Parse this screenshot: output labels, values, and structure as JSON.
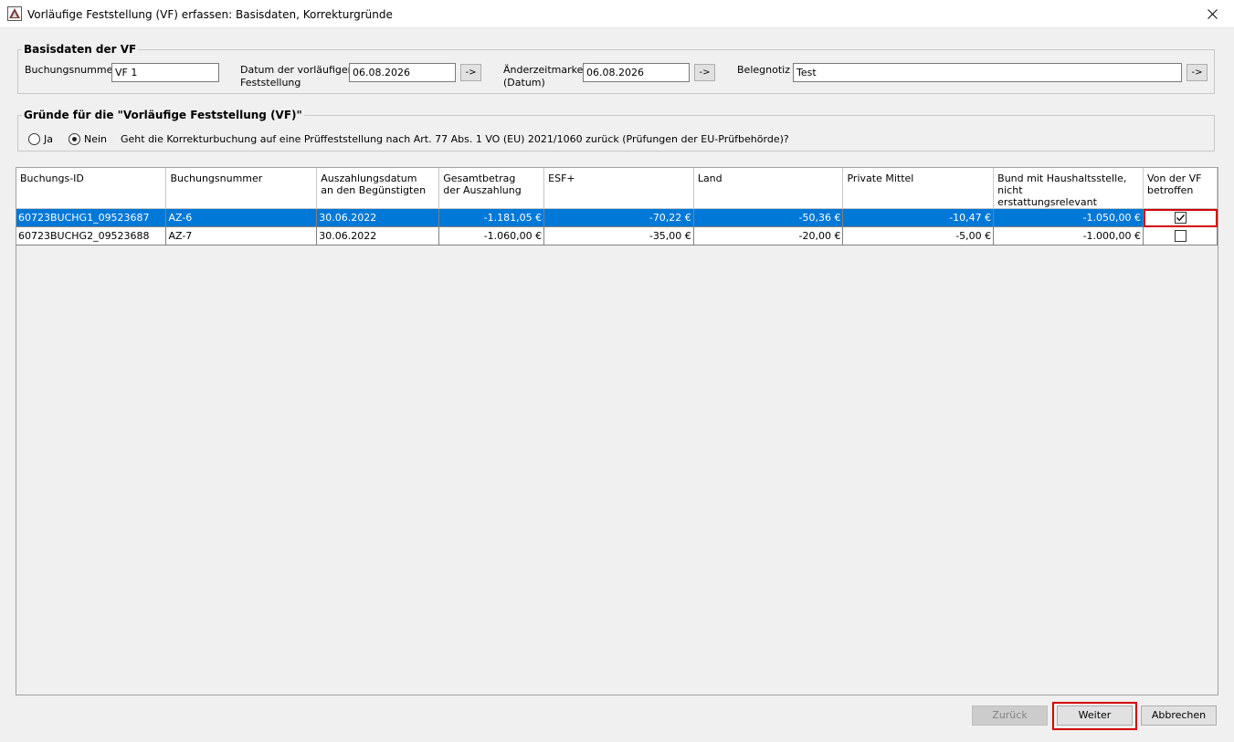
{
  "window": {
    "title": "Vorläufige Feststellung (VF) erfassen: Basisdaten, Korrekturgründe"
  },
  "basisdaten": {
    "legend": "Basisdaten der VF",
    "buchungsnummer_label": "Buchungsnummer",
    "buchungsnummer_value": "VF 1",
    "datum_label_line1": "Datum der vorläufigen",
    "datum_label_line2": "Feststellung",
    "datum_value": "06.08.2026",
    "aenderung_label_line1": "Änderzeitmarke",
    "aenderung_label_line2": "(Datum)",
    "aenderung_value": "06.08.2026",
    "belegnotiz_label": "Belegnotiz",
    "belegnotiz_value": "Test",
    "arrow_label": "->"
  },
  "gruende": {
    "legend": "Gründe für die \"Vorläufige Feststellung (VF)\"",
    "option_ja": "Ja",
    "option_nein": "Nein",
    "selected": "Nein",
    "question": "Geht die Korrekturbuchung auf eine Prüffeststellung nach Art. 77 Abs. 1 VO (EU) 2021/1060 zurück (Prüfungen der EU-Prüfbehörde)?"
  },
  "table": {
    "headers": [
      {
        "line1": "Buchungs-ID",
        "line2": ""
      },
      {
        "line1": "Buchungsnummer",
        "line2": ""
      },
      {
        "line1": "Auszahlungsdatum",
        "line2": "an den Begünstigten"
      },
      {
        "line1": "Gesamtbetrag",
        "line2": "der Auszahlung"
      },
      {
        "line1": "ESF+",
        "line2": ""
      },
      {
        "line1": "Land",
        "line2": ""
      },
      {
        "line1": "Private Mittel",
        "line2": ""
      },
      {
        "line1": "Bund mit Haushaltsstelle, nicht",
        "line2": "erstattungsrelevant"
      },
      {
        "line1": "Von der VF",
        "line2": "betroffen"
      }
    ],
    "rows": [
      {
        "id": "60723BUCHG1_09523687",
        "nummer": "AZ-6",
        "datum": "30.06.2022",
        "gesamt": "-1.181,05 €",
        "esf": "-70,22 €",
        "land": "-50,36 €",
        "privat": "-10,47 €",
        "bund": "-1.050,00 €",
        "betroffen": true,
        "selected": true
      },
      {
        "id": "60723BUCHG2_09523688",
        "nummer": "AZ-7",
        "datum": "30.06.2022",
        "gesamt": "-1.060,00 €",
        "esf": "-35,00 €",
        "land": "-20,00 €",
        "privat": "-5,00 €",
        "bund": "-1.000,00 €",
        "betroffen": false,
        "selected": false
      }
    ]
  },
  "buttons": {
    "zurueck": "Zurück",
    "weiter": "Weiter",
    "abbrechen": "Abbrechen"
  },
  "colors": {
    "selection": "#0078d7",
    "highlight": "#d40000"
  }
}
